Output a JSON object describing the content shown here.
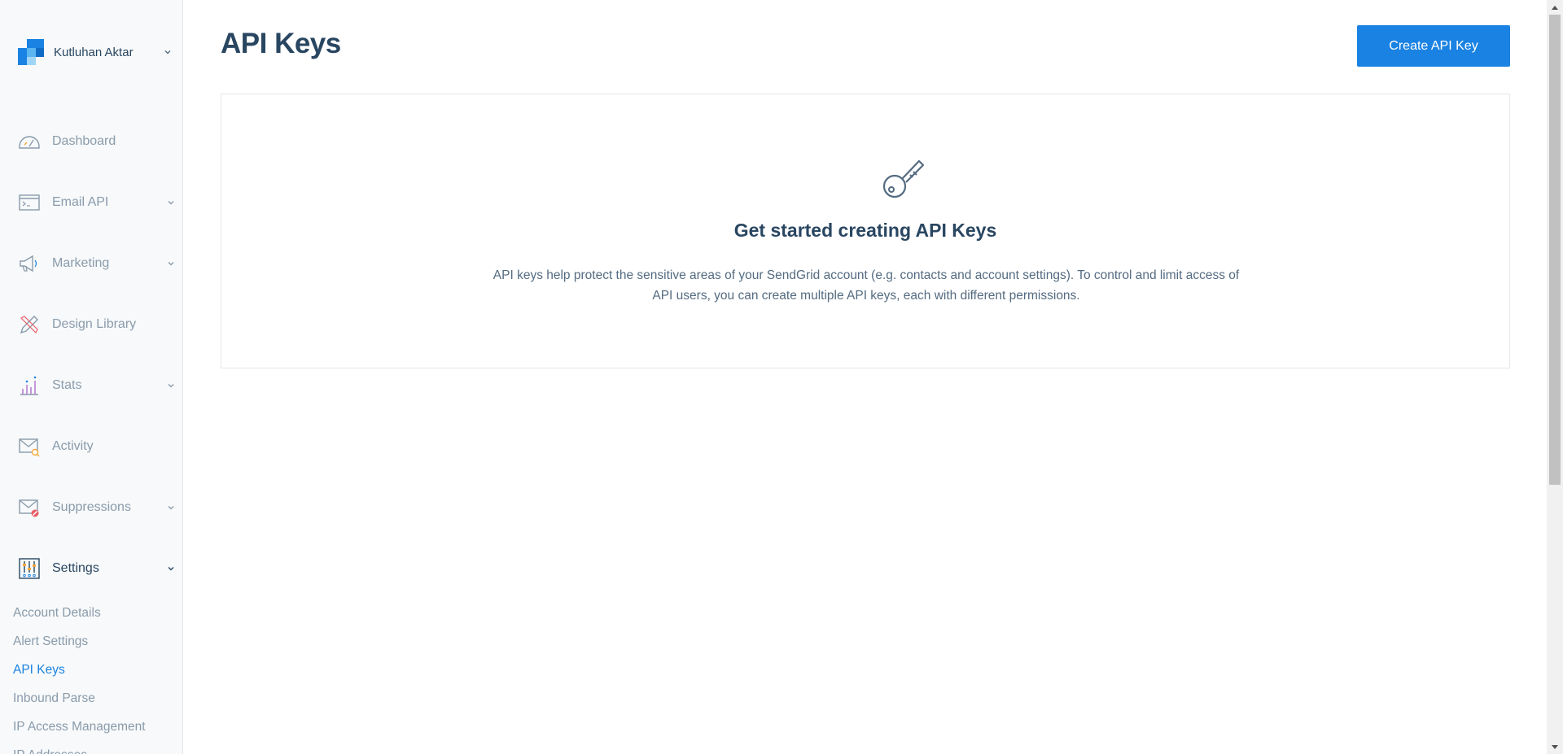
{
  "account": {
    "name": "Kutluhan Aktar",
    "icon": "chevron-down-icon"
  },
  "sidebar": {
    "items": [
      {
        "label": "Dashboard",
        "icon": "dashboard-gauge-icon",
        "has_chevron": false
      },
      {
        "label": "Email API",
        "icon": "email-api-icon",
        "has_chevron": true
      },
      {
        "label": "Marketing",
        "icon": "megaphone-icon",
        "has_chevron": true
      },
      {
        "label": "Design Library",
        "icon": "design-pencil-icon",
        "has_chevron": false
      },
      {
        "label": "Stats",
        "icon": "stats-chart-icon",
        "has_chevron": true
      },
      {
        "label": "Activity",
        "icon": "activity-envelope-icon",
        "has_chevron": false
      },
      {
        "label": "Suppressions",
        "icon": "suppressions-envelope-icon",
        "has_chevron": true
      },
      {
        "label": "Settings",
        "icon": "settings-sliders-icon",
        "has_chevron": true,
        "active": true
      }
    ],
    "settings_subitems": [
      {
        "label": "Account Details"
      },
      {
        "label": "Alert Settings"
      },
      {
        "label": "API Keys",
        "active": true
      },
      {
        "label": "Inbound Parse"
      },
      {
        "label": "IP Access Management"
      },
      {
        "label": "IP Addresses"
      }
    ]
  },
  "header": {
    "title": "API Keys",
    "create_button_label": "Create API Key"
  },
  "empty_state": {
    "icon": "key-icon",
    "title": "Get started creating API Keys",
    "description": "API keys help protect the sensitive areas of your SendGrid account (e.g. contacts and account settings). To control and limit access of API users, you can create multiple API keys, each with different permissions."
  },
  "colors": {
    "primary": "#1a82e2",
    "heading": "#294661",
    "muted": "#8a9bab",
    "sidebar_bg": "#f7f9fa"
  }
}
